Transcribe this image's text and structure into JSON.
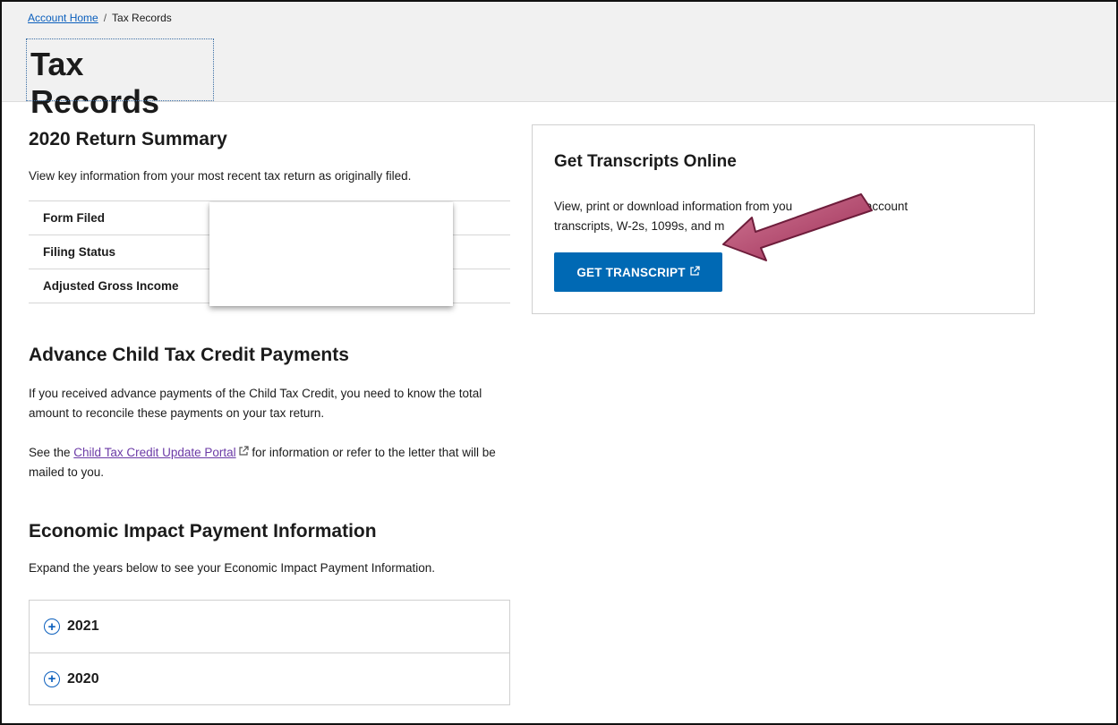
{
  "breadcrumb": {
    "home": "Account Home",
    "separator": "/",
    "current": "Tax Records"
  },
  "page": {
    "title": "Tax Records"
  },
  "summary": {
    "title": "2020 Return Summary",
    "description": "View key information from your most recent tax return as originally filed.",
    "rows": [
      {
        "label": "Form Filed"
      },
      {
        "label": "Filing Status"
      },
      {
        "label": "Adjusted Gross Income"
      }
    ]
  },
  "child_tax_credit": {
    "title": "Advance Child Tax Credit Payments",
    "paragraph1": "If you received advance payments of the Child Tax Credit, you need to know the total amount to reconcile these payments on your tax return.",
    "paragraph2_prefix": "See the ",
    "portal_link": "Child Tax Credit Update Portal",
    "paragraph2_suffix": " for information or refer to the letter that will be mailed to you."
  },
  "economic_impact": {
    "title": "Economic Impact Payment Information",
    "description": "Expand the years below to see your Economic Impact Payment Information.",
    "years": [
      "2021",
      "2020"
    ]
  },
  "transcripts": {
    "title": "Get Transcripts Online",
    "description_visible_1": "View, print or download information from you",
    "description_visible_2": "urns, account",
    "description_visible_3": "transcripts, W-2s, 1099s, and m",
    "button_label": "GET TRANSCRIPT"
  },
  "icons": {
    "external_link": "external-link-icon",
    "expand": "plus-circle-icon",
    "annotation_arrow": "arrow-annotation"
  },
  "colors": {
    "accent_blue": "#0069b4",
    "link_blue": "#0b5fbd",
    "visited_link": "#6b3aa6",
    "arrow": "#b0406a"
  }
}
